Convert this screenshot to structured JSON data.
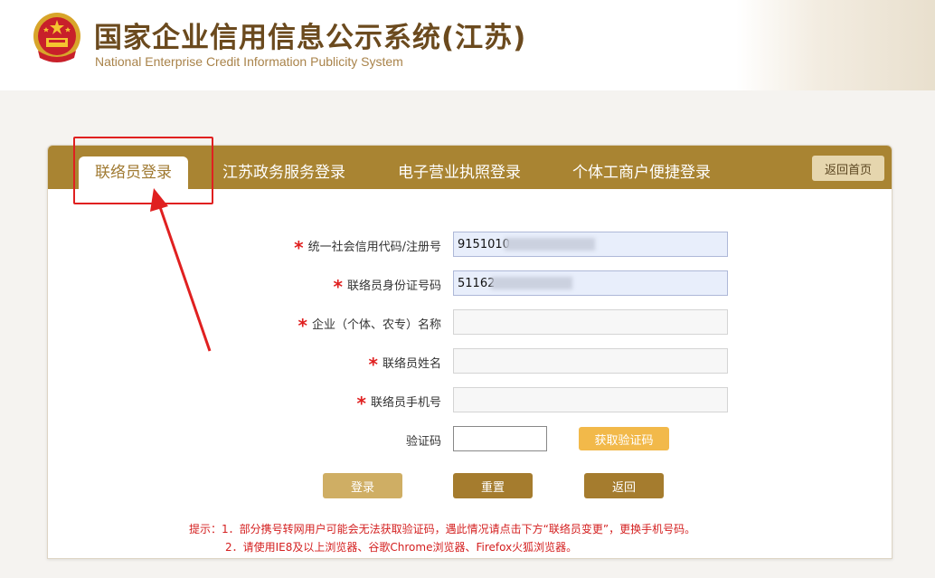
{
  "header": {
    "title": "国家企业信用信息公示系统(江苏)",
    "subtitle": "National Enterprise Credit Information Publicity System"
  },
  "tabs": [
    {
      "label": "联络员登录",
      "active": true
    },
    {
      "label": "江苏政务服务登录",
      "active": false
    },
    {
      "label": "电子营业执照登录",
      "active": false
    },
    {
      "label": "个体工商户便捷登录",
      "active": false
    }
  ],
  "home_button": "返回首页",
  "form": {
    "credit_code": {
      "label": "统一社会信用代码/注册号",
      "value": "9151010"
    },
    "id_number": {
      "label": "联络员身份证号码",
      "value": "51162"
    },
    "enterprise_name": {
      "label": "企业（个体、农专）名称",
      "value": ""
    },
    "contact_name": {
      "label": "联络员姓名",
      "value": ""
    },
    "contact_phone": {
      "label": "联络员手机号",
      "value": ""
    },
    "captcha": {
      "label": "验证码",
      "value": "",
      "button": "获取验证码"
    }
  },
  "buttons": {
    "login": "登录",
    "reset": "重置",
    "back": "返回"
  },
  "tips": {
    "line1": "提示：1．部分携号转网用户可能会无法获取验证码，遇此情况请点击下方“联络员变更”，更换手机号码。",
    "line2": "2．请使用IE8及以上浏览器、谷歌Chrome浏览器、Firefox火狐浏览器。"
  },
  "colors": {
    "tabbar": "#a98432",
    "annotation": "#e02020",
    "accent": "#f2b94a"
  }
}
